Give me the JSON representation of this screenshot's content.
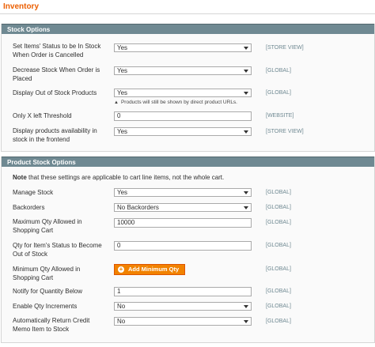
{
  "page": {
    "title": "Inventory"
  },
  "stock_options": {
    "header": "Stock Options",
    "rows": [
      {
        "label": "Set Items' Status to be In Stock When Order is Cancelled",
        "value": "Yes",
        "scope": "[STORE VIEW]"
      },
      {
        "label": "Decrease Stock When Order is Placed",
        "value": "Yes",
        "scope": "[GLOBAL]"
      },
      {
        "label": "Display Out of Stock Products",
        "value": "Yes",
        "scope": "[GLOBAL]",
        "note": "Products will still be shown by direct product URLs."
      },
      {
        "label": "Only X left Threshold",
        "value": "0",
        "scope": "[WEBSITE]"
      },
      {
        "label": "Display products availability in stock in the frontend",
        "value": "Yes",
        "scope": "[STORE VIEW]"
      }
    ]
  },
  "product_stock_options": {
    "header": "Product Stock Options",
    "note_bold": "Note",
    "note_text": " that these settings are applicable to cart line items, not the whole cart.",
    "rows": [
      {
        "label": "Manage Stock",
        "value": "Yes",
        "scope": "[GLOBAL]"
      },
      {
        "label": "Backorders",
        "value": "No Backorders",
        "scope": "[GLOBAL]"
      },
      {
        "label": "Maximum Qty Allowed in Shopping Cart",
        "value": "10000",
        "scope": "[GLOBAL]"
      },
      {
        "label": "Qty for Item's Status to Become Out of Stock",
        "value": "0",
        "scope": "[GLOBAL]"
      },
      {
        "label": "Minimum Qty Allowed in Shopping Cart",
        "button": "Add Minimum Qty",
        "scope": "[GLOBAL]"
      },
      {
        "label": "Notify for Quantity Below",
        "value": "1",
        "scope": "[GLOBAL]"
      },
      {
        "label": "Enable Qty Increments",
        "value": "No",
        "scope": "[GLOBAL]"
      },
      {
        "label": "Automatically Return Credit Memo Item to Stock",
        "value": "No",
        "scope": "[GLOBAL]"
      }
    ]
  },
  "colors": {
    "title": "#eb5e00",
    "header_bg": "#6f8992",
    "button": "#f18200",
    "scope": "#6f8992"
  }
}
